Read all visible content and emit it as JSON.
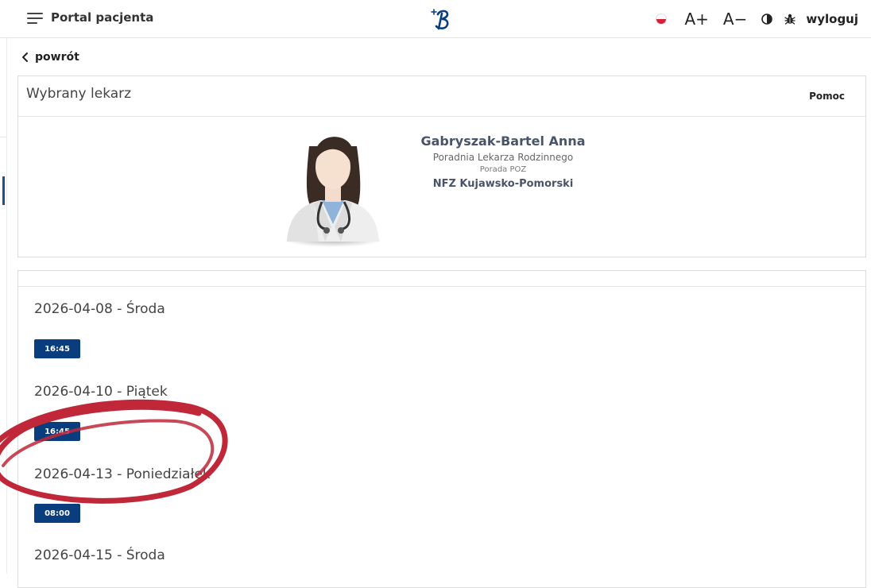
{
  "header": {
    "title": "Portal pacjenta",
    "font_increase": "A+",
    "font_decrease": "A−",
    "logout": "wyloguj",
    "icons": [
      "menu-icon",
      "logo-icon",
      "flag-pl-icon",
      "contrast-icon",
      "bug-icon"
    ]
  },
  "nav": {
    "back_label": "powrót"
  },
  "doctor_card": {
    "title": "Wybrany lekarz",
    "help_label": "Pomoc",
    "name": "Gabryszak-Bartel Anna",
    "clinic": "Poradnia Lekarza Rodzinnego",
    "service": "Porada POZ",
    "nfz": "NFZ Kujawsko-Pomorski"
  },
  "slots": [
    {
      "date": "2026-04-08 - Środa",
      "times": [
        "16:45"
      ]
    },
    {
      "date": "2026-04-10 - Piątek",
      "times": [
        "16:45"
      ]
    },
    {
      "date": "2026-04-13 - Poniedziałek",
      "times": [
        "08:00"
      ]
    },
    {
      "date": "2026-04-15 - Środa",
      "times": []
    }
  ],
  "colors": {
    "primary": "#0a3d7e",
    "accent_strip": "#1d4f91",
    "annotation": "#c0283a",
    "flag_red": "#d4213d"
  }
}
